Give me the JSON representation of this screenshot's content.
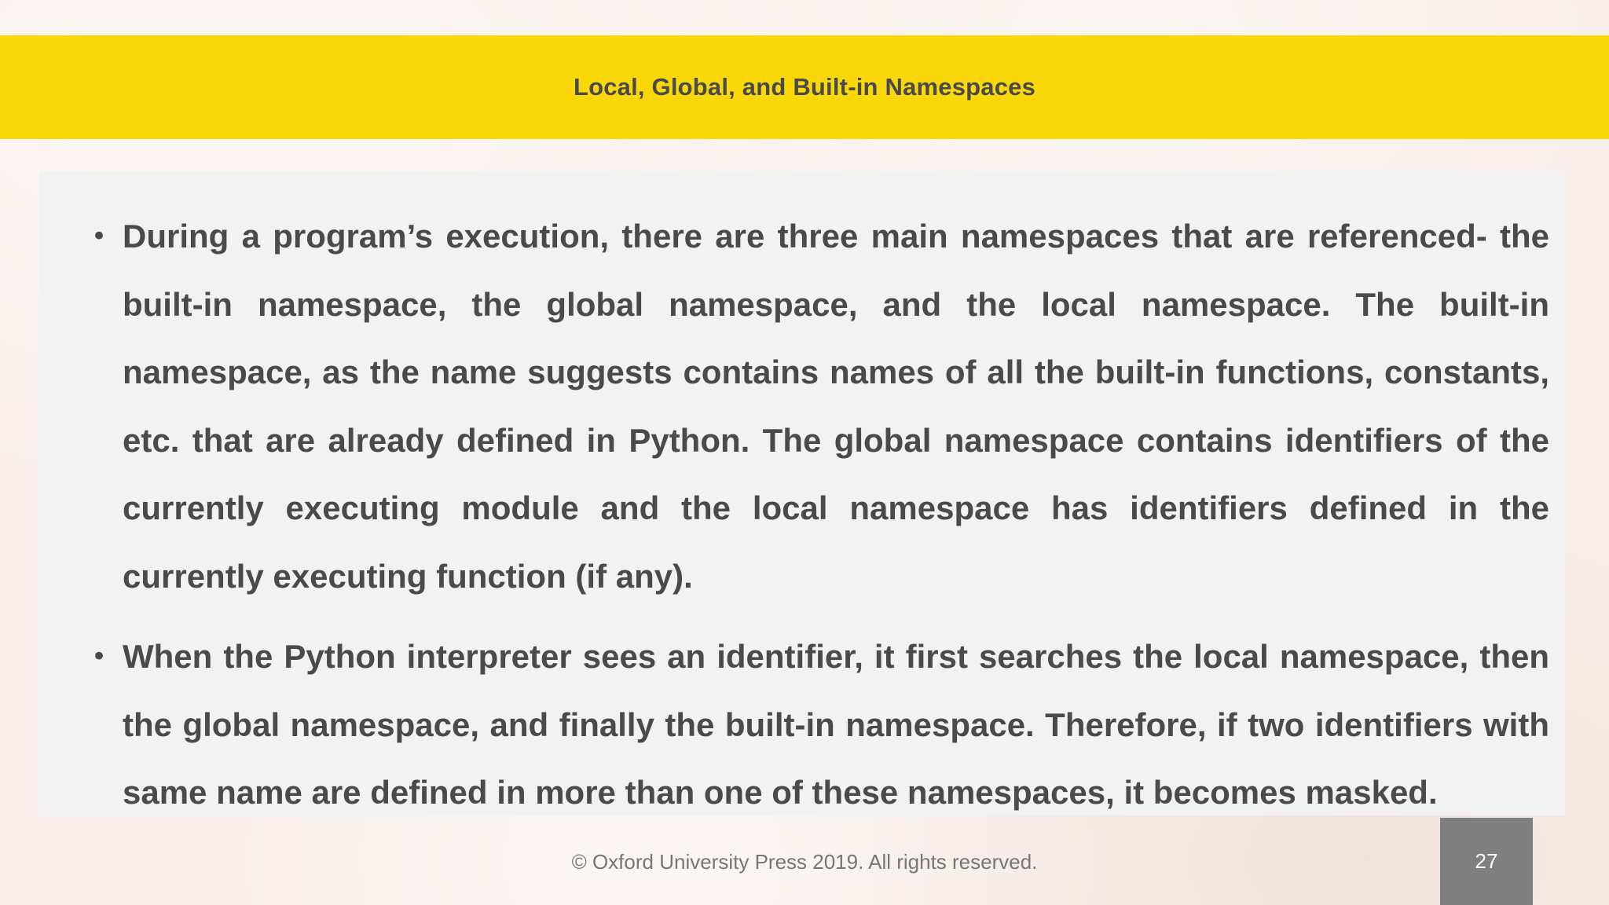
{
  "slide": {
    "title": "Local, Global, and Built-in Namespaces",
    "bullets": [
      {
        "text": "During a program’s execution, there are three main namespaces that are referenced- the built-in namespace, the global namespace, and the local namespace. The built-in namespace, as the name suggests contains names of all the built-in functions, constants, etc. that are already defined in Python. The global namespace contains identifiers of the currently executing module and the local namespace has identifiers defined in the currently executing function (if any)."
      },
      {
        "text": "When the Python interpreter sees an identifier, it first searches the local namespace, then the global namespace, and finally the built-in namespace. Therefore, if two identifiers with same name are defined in more than one of these namespaces, it becomes masked."
      }
    ],
    "bullet_symbol": "•",
    "footer": "© Oxford University Press 2019. All rights reserved.",
    "page_number": "27"
  },
  "colors": {
    "title_bar": "#fad807",
    "text": "#4a4a4a",
    "content_background": "#f2f2f2",
    "page_box": "#7f7f7f"
  }
}
